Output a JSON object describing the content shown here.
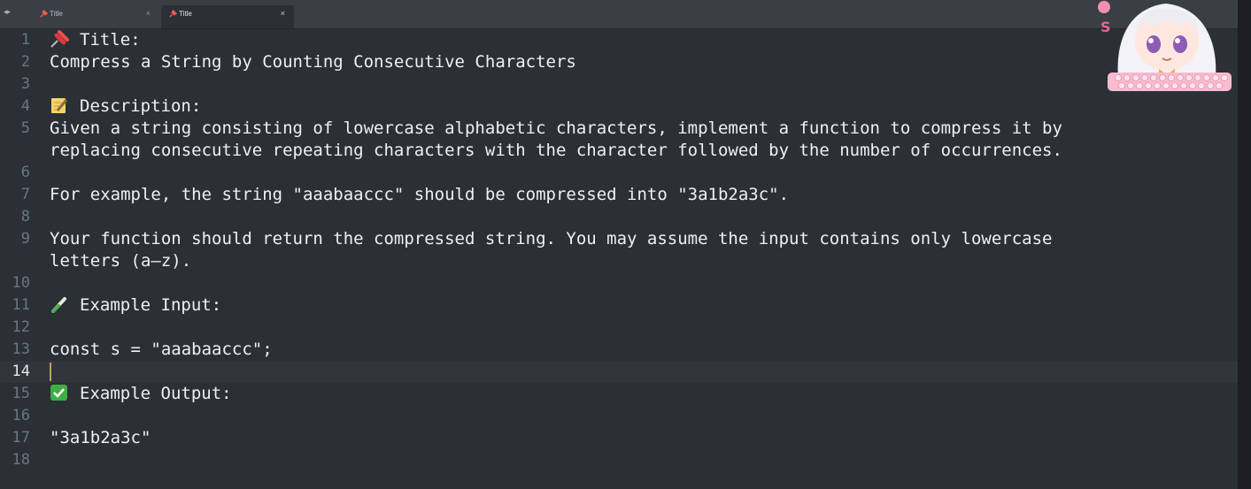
{
  "tabs": [
    {
      "label": "Title",
      "active": false
    },
    {
      "label": "Title",
      "active": true
    }
  ],
  "nav": {
    "arrows": "◂▸"
  },
  "tab_close_glyph": "×",
  "editor": {
    "current_line": 14,
    "lines": [
      {
        "n": "1",
        "emoji": "pushpin-icon",
        "text": "Title:"
      },
      {
        "n": "2",
        "text": "Compress a String by Counting Consecutive Characters"
      },
      {
        "n": "3",
        "text": ""
      },
      {
        "n": "4",
        "emoji": "memo-icon",
        "text": "Description:"
      },
      {
        "n": "5",
        "text": "Given a string consisting of lowercase alphabetic characters, implement a function to compress it by"
      },
      {
        "n": "",
        "text": "replacing consecutive repeating characters with the character followed by the number of occurrences."
      },
      {
        "n": "6",
        "text": ""
      },
      {
        "n": "7",
        "text": "For example, the string \"aaabaaccc\" should be compressed into \"3a1b2a3c\"."
      },
      {
        "n": "8",
        "text": ""
      },
      {
        "n": "9",
        "text": "Your function should return the compressed string. You may assume the input contains only lowercase"
      },
      {
        "n": "",
        "text": "letters (a–z)."
      },
      {
        "n": "10",
        "text": ""
      },
      {
        "n": "11",
        "emoji": "test-tube-icon",
        "text": "Example Input:"
      },
      {
        "n": "12",
        "text": ""
      },
      {
        "n": "13",
        "text": "const s = \"aaabaaccc\";"
      },
      {
        "n": "14",
        "text": ""
      },
      {
        "n": "15",
        "emoji": "check-mark-icon",
        "text": "Example Output:"
      },
      {
        "n": "16",
        "text": ""
      },
      {
        "n": "17",
        "text": "\"3a1b2a3c\""
      },
      {
        "n": "18",
        "text": ""
      }
    ]
  },
  "colors": {
    "background": "#2b2f36",
    "text": "#eef0f3",
    "line_number": "#6e7580",
    "cursor": "#c8a24a",
    "pin": "#ff5a5a",
    "check": "#3cb043"
  },
  "mascot": {
    "badge": "S"
  }
}
